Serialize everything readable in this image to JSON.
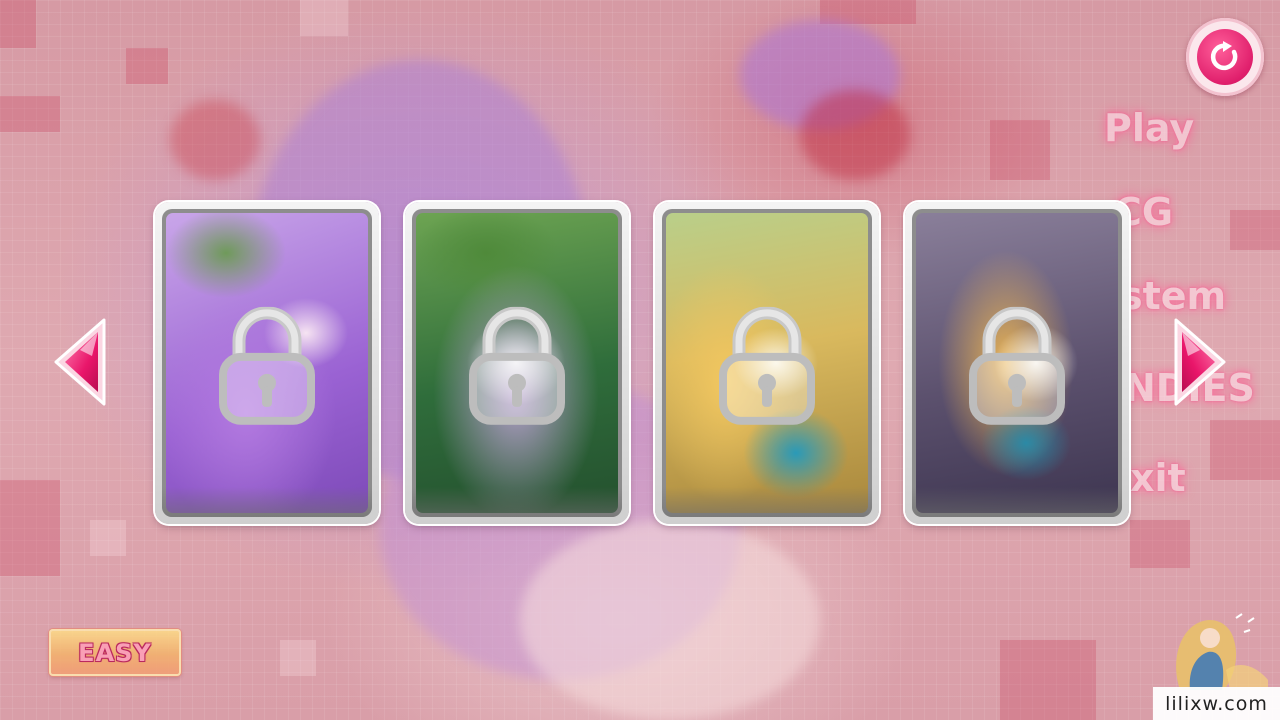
{
  "menu": {
    "items": [
      {
        "label": "Play"
      },
      {
        "label": "CG"
      },
      {
        "label": "stem"
      },
      {
        "label": "NDIES"
      },
      {
        "label": "xit"
      }
    ]
  },
  "gallery": {
    "cards": [
      {
        "locked": true,
        "icon": "lock-icon"
      },
      {
        "locked": true,
        "icon": "lock-icon"
      },
      {
        "locked": true,
        "icon": "lock-icon"
      },
      {
        "locked": true,
        "icon": "lock-icon"
      }
    ]
  },
  "difficulty": {
    "label": "EASY"
  },
  "watermark": {
    "text": "lilixw.com"
  },
  "colors": {
    "accent": "#e01f6c",
    "menu_glow": "#ff6a9c",
    "card_frame": "#d6d6d6",
    "difficulty_bg": "#f4b26a"
  }
}
